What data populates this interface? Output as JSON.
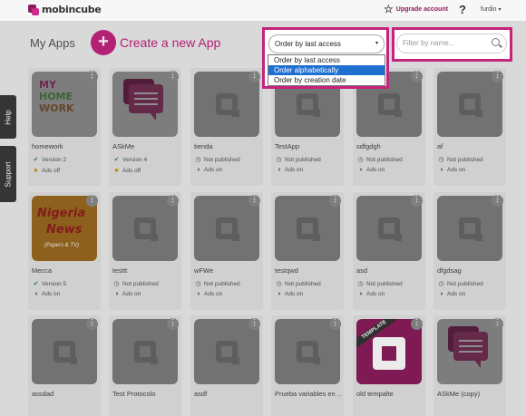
{
  "header": {
    "logo_text": "mobincube",
    "upgrade_label": "Upgrade account",
    "help_label": "?",
    "user_name": "furdin"
  },
  "page": {
    "title": "My Apps",
    "create_label": "Create a new App",
    "create_icon": "+"
  },
  "side_tabs": {
    "help": "Help",
    "support": "Support"
  },
  "sort": {
    "selected": "Order by last access",
    "options": [
      "Order by last access",
      "Order alphabetically",
      "Order by creation date"
    ],
    "highlighted": "Order alphabetically"
  },
  "filter": {
    "placeholder": "Filter by name..."
  },
  "apps": [
    {
      "name": "homework",
      "status": "Version 2",
      "ads": "Ads off",
      "thumb": "homework"
    },
    {
      "name": "ASkMe",
      "status": "Version 4",
      "ads": "Ads off",
      "thumb": "askme"
    },
    {
      "name": "tienda",
      "status": "Not published",
      "ads": "Ads on",
      "thumb": "plain"
    },
    {
      "name": "TestApp",
      "status": "Not published",
      "ads": "Ads on",
      "thumb": "plain"
    },
    {
      "name": "sdfgdgh",
      "status": "Not published",
      "ads": "Ads on",
      "thumb": "plain"
    },
    {
      "name": "af",
      "status": "Not published",
      "ads": "Ads on",
      "thumb": "plain"
    },
    {
      "name": "Mecca",
      "status": "Version 5",
      "ads": "Ads on",
      "thumb": "mecca"
    },
    {
      "name": "testtt",
      "status": "Not published",
      "ads": "Ads on",
      "thumb": "plain"
    },
    {
      "name": "wFWe",
      "status": "Not published",
      "ads": "Ads on",
      "thumb": "plain"
    },
    {
      "name": "testqwd",
      "status": "Not published",
      "ads": "Ads on",
      "thumb": "plain"
    },
    {
      "name": "asd",
      "status": "Not published",
      "ads": "Ads on",
      "thumb": "plain"
    },
    {
      "name": "dfgdsag",
      "status": "Not published",
      "ads": "Ads on",
      "thumb": "plain"
    },
    {
      "name": "assdad",
      "thumb": "plain"
    },
    {
      "name": "Test Protocolo",
      "thumb": "plain"
    },
    {
      "name": "asdf",
      "thumb": "plain"
    },
    {
      "name": "Prueba variables en ...",
      "thumb": "plain"
    },
    {
      "name": "old tempalte",
      "thumb": "template"
    },
    {
      "name": "ASkMe (copy)",
      "thumb": "askme"
    }
  ],
  "thumb_text": {
    "homework": [
      "MY",
      "HOME",
      "WORK"
    ],
    "mecca": [
      "Nigeria",
      "News",
      "(Papers & TV)"
    ],
    "template": "TEMPLATE"
  },
  "colors": {
    "brand": "#c4237e",
    "selected_option": "#1e6fd0"
  },
  "icons": {
    "more": "more-options-icon",
    "published": "rocket-icon",
    "not_published": "clock-icon",
    "ads_off": "star-icon",
    "ads_on": "megaphone-icon"
  }
}
